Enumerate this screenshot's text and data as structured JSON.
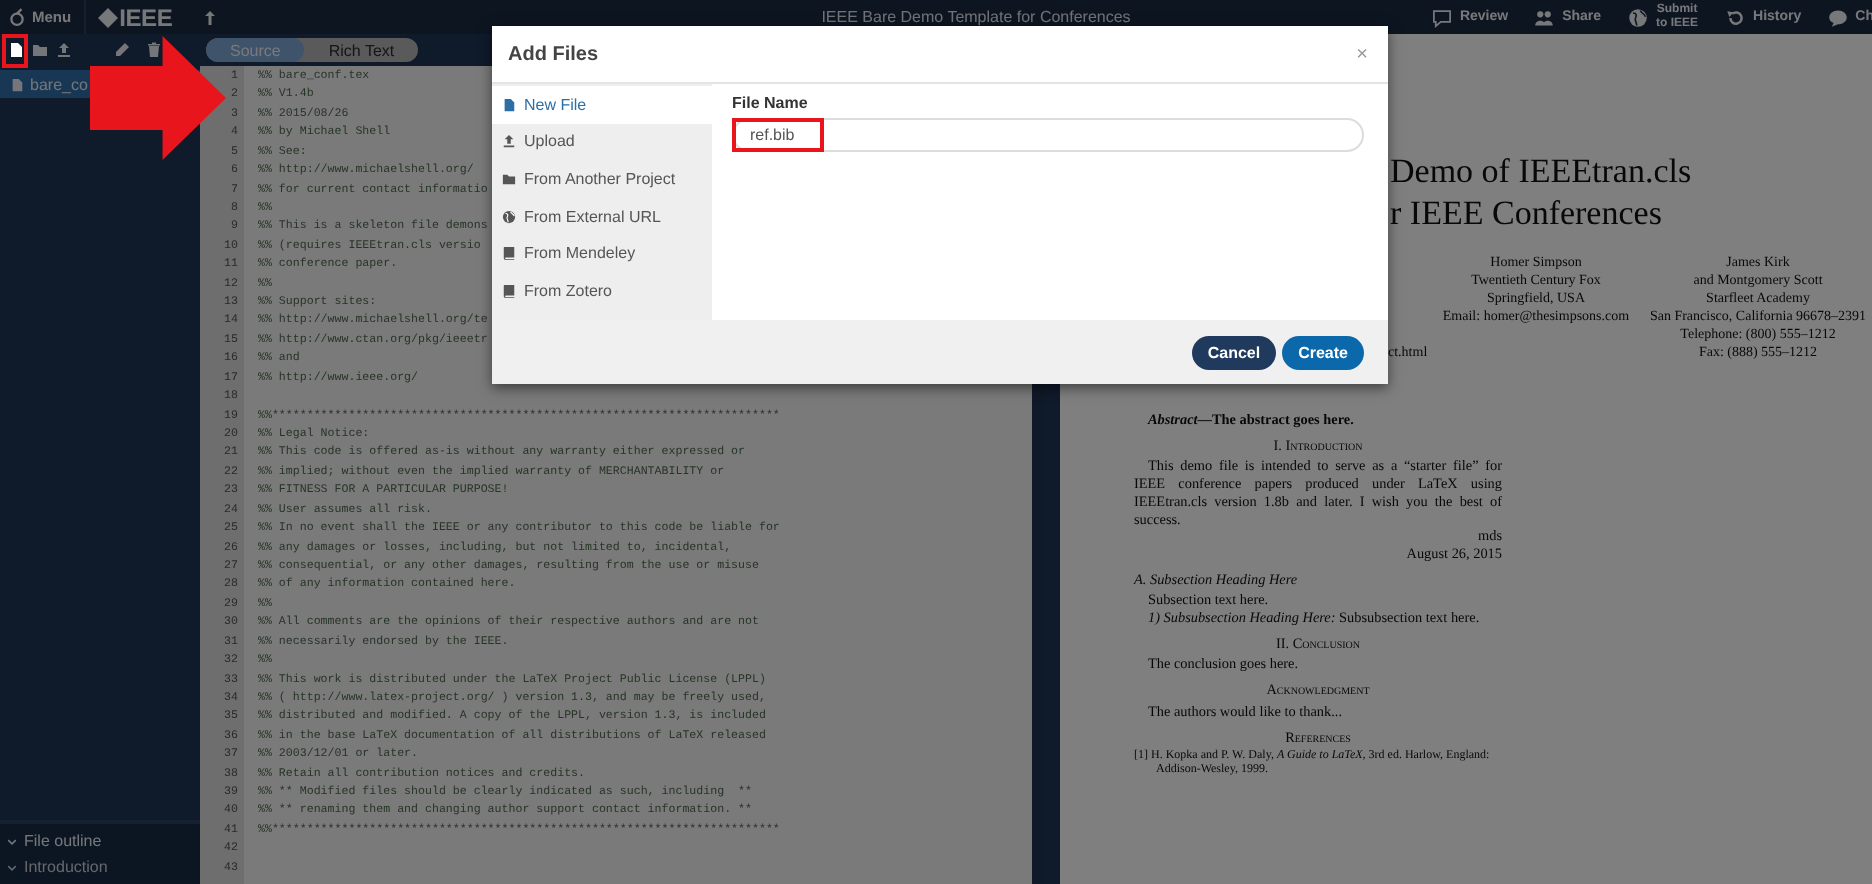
{
  "top_bar": {
    "menu_label": "Menu",
    "logo_text": "IEEE",
    "title": "IEEE Bare Demo Template for Conferences",
    "actions": [
      {
        "kind": "review",
        "label": "Review"
      },
      {
        "kind": "share",
        "label": "Share"
      },
      {
        "kind": "submit",
        "label": "Submit to IEEE"
      },
      {
        "kind": "history",
        "label": "History"
      },
      {
        "kind": "chat",
        "label": "Ch"
      }
    ]
  },
  "file_tree": {
    "tools": [
      {
        "kind": "new-file",
        "highlighted": true
      },
      {
        "kind": "new-folder",
        "highlighted": false
      },
      {
        "kind": "upload",
        "highlighted": false
      },
      {
        "kind": "rename",
        "highlighted": false
      },
      {
        "kind": "delete",
        "highlighted": false
      }
    ],
    "files": [
      {
        "name": "bare_co",
        "selected": true
      }
    ]
  },
  "file_outline": {
    "title": "File outline",
    "expanded": true,
    "items": [
      {
        "label": "Introduction",
        "expanded": true
      }
    ]
  },
  "editor": {
    "modes": [
      {
        "label": "Source",
        "selected": true
      },
      {
        "label": "Rich Text",
        "selected": false
      }
    ],
    "lines": [
      {
        "number": "1",
        "text": "%% bare_conf.tex"
      },
      {
        "number": "2",
        "text": "%% V1.4b"
      },
      {
        "number": "3",
        "text": "%% 2015/08/26"
      },
      {
        "number": "4",
        "text": "%% by Michael Shell"
      },
      {
        "number": "5",
        "text": "%% See:"
      },
      {
        "number": "6",
        "text": "%% http://www.michaelshell.org/"
      },
      {
        "number": "7",
        "text": "%% for current contact informatio"
      },
      {
        "number": "8",
        "text": "%%"
      },
      {
        "number": "9",
        "text": "%% This is a skeleton file demons"
      },
      {
        "number": "10",
        "text": "%% (requires IEEEtran.cls versio"
      },
      {
        "number": "11",
        "text": "%% conference paper."
      },
      {
        "number": "12",
        "text": "%%"
      },
      {
        "number": "13",
        "text": "%% Support sites:"
      },
      {
        "number": "14",
        "text": "%% http://www.michaelshell.org/te"
      },
      {
        "number": "15",
        "text": "%% http://www.ctan.org/pkg/ieeetr"
      },
      {
        "number": "16",
        "text": "%% and"
      },
      {
        "number": "17",
        "text": "%% http://www.ieee.org/"
      },
      {
        "number": "18"
      },
      {
        "number": "19",
        "text": "%%*************************************************************************"
      },
      {
        "number": "20",
        "text": "%% Legal Notice:"
      },
      {
        "number": "21",
        "text": "%% This code is offered as-is without any warranty either expressed or"
      },
      {
        "number": "22",
        "text": "%% implied; without even the implied warranty of MERCHANTABILITY or"
      },
      {
        "number": "23",
        "text": "%% FITNESS FOR A PARTICULAR PURPOSE!"
      },
      {
        "number": "24",
        "text": "%% User assumes all risk."
      },
      {
        "number": "25",
        "text": "%% In no event shall the IEEE or any contributor to this code be liable for"
      },
      {
        "number": "26",
        "text": "%% any damages or losses, including, but not limited to, incidental,"
      },
      {
        "number": "27",
        "text": "%% consequential, or any other damages, resulting from the use or misuse"
      },
      {
        "number": "28",
        "text": "%% of any information contained here."
      },
      {
        "number": "29",
        "text": "%%"
      },
      {
        "number": "30",
        "text": "%% All comments are the opinions of their respective authors and are not"
      },
      {
        "number": "31",
        "text": "%% necessarily endorsed by the IEEE."
      },
      {
        "number": "32",
        "text": "%%"
      },
      {
        "number": "33",
        "text": "%% This work is distributed under the LaTeX Project Public License (LPPL)"
      },
      {
        "number": "34",
        "text": "%% ( http://www.latex-project.org/ ) version 1.3, and may be freely used,"
      },
      {
        "number": "35",
        "text": "%% distributed and modified. A copy of the LPPL, version 1.3, is included"
      },
      {
        "number": "36",
        "text": "%% in the base LaTeX documentation of all distributions of LaTeX released"
      },
      {
        "number": "37",
        "text": "%% 2003/12/01 or later."
      },
      {
        "number": "38",
        "text": "%% Retain all contribution notices and credits."
      },
      {
        "number": "39",
        "text": "%% ** Modified files should be clearly indicated as such, including  **"
      },
      {
        "number": "40",
        "text": "%% ** renaming them and changing author support contact information. **"
      },
      {
        "number": "41",
        "text": "%%*************************************************************************"
      },
      {
        "number": "42"
      },
      {
        "number": "43"
      }
    ]
  },
  "pdf": {
    "title_lines": [
      "Demo of IEEEtran.cls",
      "r IEEE Conferences"
    ],
    "authors": [
      {
        "lines": [
          "Homer Simpson",
          "Twentieth Century Fox",
          "Springfield, USA",
          "Email: homer@thesimpsons.com"
        ]
      },
      {
        "lines": [
          "James Kirk",
          "and Montgomery Scott",
          "Starfleet Academy",
          "San Francisco, California 96678–2391",
          "Telephone: (800) 555–1212",
          "Fax: (888) 555–1212"
        ]
      }
    ],
    "fragment": "ct.html",
    "body": [
      {
        "kind": "abstract",
        "text": "*Abstract*—The abstract goes here."
      },
      {
        "kind": "heading",
        "text": "I. Introduction"
      },
      {
        "kind": "paragraph",
        "text": "This demo file is intended to serve as a “starter file” for IEEE conference papers produced under LaTeX using IEEEtran.cls version 1.8b and later. I wish you the best of success."
      },
      {
        "kind": "signature",
        "text": "mds"
      },
      {
        "kind": "signature",
        "text": "August 26, 2015"
      },
      {
        "kind": "subsection",
        "text": "A. Subsection Heading Here"
      },
      {
        "kind": "paragraph",
        "text": "Subsection text here."
      },
      {
        "kind": "paragraph",
        "text": "*1) Subsubsection Heading Here:* Subsubsection text here."
      },
      {
        "kind": "heading",
        "text": "II. Conclusion"
      },
      {
        "kind": "paragraph",
        "text": "The conclusion goes here."
      },
      {
        "kind": "heading",
        "text": "Acknowledgment"
      },
      {
        "kind": "paragraph",
        "text": "The authors would like to thank..."
      },
      {
        "kind": "heading",
        "text": "References"
      },
      {
        "kind": "reference",
        "text": "[1] H. Kopka and P. W. Daly, *A Guide to LaTeX*, 3rd ed.   Harlow, England: Addison-Wesley, 1999."
      }
    ]
  },
  "dialog": {
    "title": "Add Files",
    "close_label": "×",
    "sources": [
      {
        "kind": "file",
        "label": "New File",
        "selected": true
      },
      {
        "kind": "upload",
        "label": "Upload",
        "selected": false
      },
      {
        "kind": "folder",
        "label": "From Another Project",
        "selected": false
      },
      {
        "kind": "globe",
        "label": "From External URL",
        "selected": false
      },
      {
        "kind": "book",
        "label": "From Mendeley",
        "selected": false
      },
      {
        "kind": "book",
        "label": "From Zotero",
        "selected": false
      }
    ],
    "field_label": "File Name",
    "file_name": "ref.bib",
    "file_name_highlighted": true,
    "buttons": [
      {
        "kind": "cancel",
        "label": "Cancel"
      },
      {
        "kind": "primary",
        "label": "Create"
      }
    ]
  }
}
